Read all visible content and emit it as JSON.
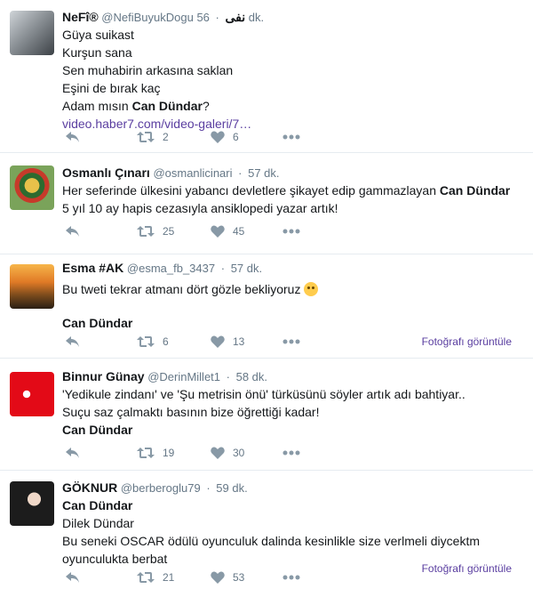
{
  "colors": {
    "link": "#5a3ea0",
    "muted": "#657786",
    "icon": "#8899a6",
    "divider": "#e6ecf0"
  },
  "tweets": [
    {
      "name": "NeFî®",
      "handle": "@NefiBuyukDogu",
      "handle_suffix": "نفی",
      "time": "56 dk.",
      "lines": [
        "Güya suikast",
        "Kurşun sana",
        "Sen muhabirin arkasına saklan",
        "Eşini de bırak kaç"
      ],
      "line_last_prefix": "Adam mısın ",
      "line_last_bold": "Can Dündar",
      "line_last_suffix": "?",
      "link": "video.haber7.com/video-galeri/7…",
      "retweets": "2",
      "likes": "6",
      "icons": [
        "reply-icon",
        "retweet-icon",
        "like-icon",
        "more-icon"
      ]
    },
    {
      "name": "Osmanlı Çınarı",
      "handle": "@osmanlicinari",
      "time": "57 dk.",
      "line1_prefix": "Her seferinde ülkesini yabancı devletlere şikayet edip gammazlayan ",
      "line1_bold": "Can Dündar",
      "line2": "5 yıl 10 ay hapis cezasıyla ansiklopedi yazar artık!",
      "retweets": "25",
      "likes": "45"
    },
    {
      "name": "Esma #AK",
      "handle": "@esma_fb_3437",
      "time": "57 dk.",
      "line1": "Bu tweti tekrar atmanı dört gözle bekliyoruz",
      "emoji": "smiley-emoji",
      "line3_bold": "Can Dündar",
      "retweets": "6",
      "likes": "13",
      "photo_link": "Fotoğrafı görüntüle"
    },
    {
      "name": "Binnur Günay",
      "handle": "@DerinMillet1",
      "time": "58 dk.",
      "line1": "'Yedikule zindanı' ve 'Şu metrisin önü' türküsünü söyler artık adı bahtiyar..",
      "line2": "Suçu saz çalmaktı basının bize öğrettiği kadar!",
      "line3_bold": "Can Dündar",
      "retweets": "19",
      "likes": "30"
    },
    {
      "name": "GÖKNUR",
      "handle": "@berberoglu79",
      "time": "59 dk.",
      "line1_bold": "Can Dündar",
      "line2": "Dilek Dündar",
      "line3": "Bu seneki OSCAR ödülü oyunculuk dalinda kesinlikle size verlmeli diycektm",
      "line4": "oyunculukta berbat",
      "retweets": "21",
      "likes": "53",
      "photo_link": "Fotoğrafı görüntüle"
    }
  ]
}
